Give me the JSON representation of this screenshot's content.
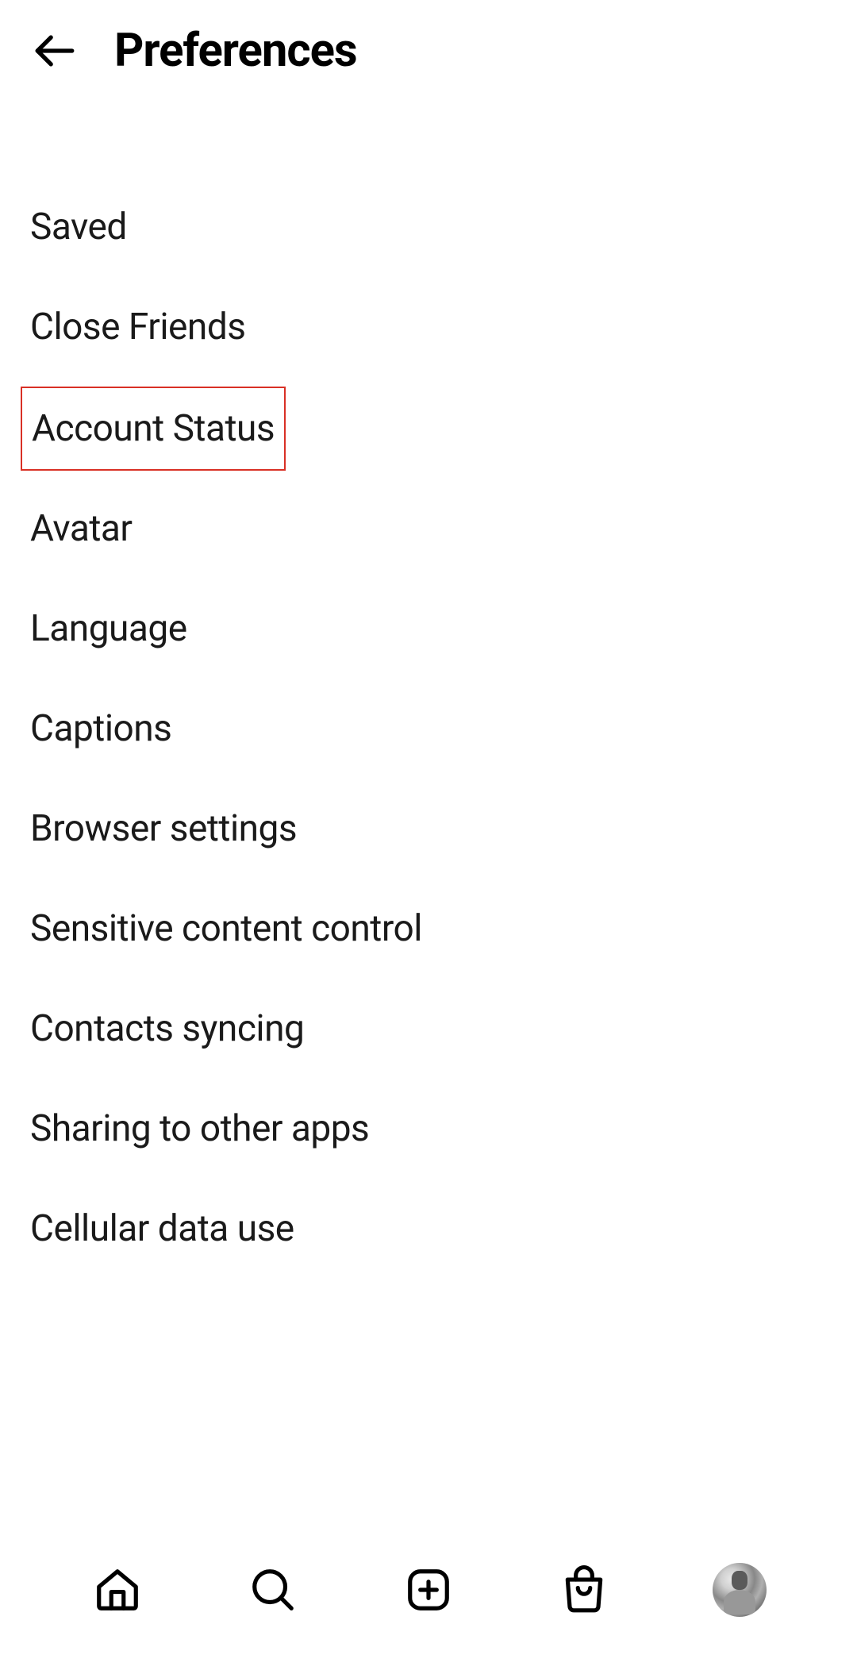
{
  "header": {
    "title": "Preferences"
  },
  "list": {
    "items": [
      {
        "label": "Saved",
        "highlighted": false
      },
      {
        "label": "Close Friends",
        "highlighted": false
      },
      {
        "label": "Account Status",
        "highlighted": true
      },
      {
        "label": "Avatar",
        "highlighted": false
      },
      {
        "label": "Language",
        "highlighted": false
      },
      {
        "label": "Captions",
        "highlighted": false
      },
      {
        "label": "Browser settings",
        "highlighted": false
      },
      {
        "label": "Sensitive content control",
        "highlighted": false
      },
      {
        "label": "Contacts syncing",
        "highlighted": false
      },
      {
        "label": "Sharing to other apps",
        "highlighted": false
      },
      {
        "label": "Cellular data use",
        "highlighted": false
      }
    ]
  },
  "nav": {
    "items": [
      {
        "name": "home"
      },
      {
        "name": "search"
      },
      {
        "name": "create"
      },
      {
        "name": "shop"
      },
      {
        "name": "profile"
      }
    ]
  }
}
